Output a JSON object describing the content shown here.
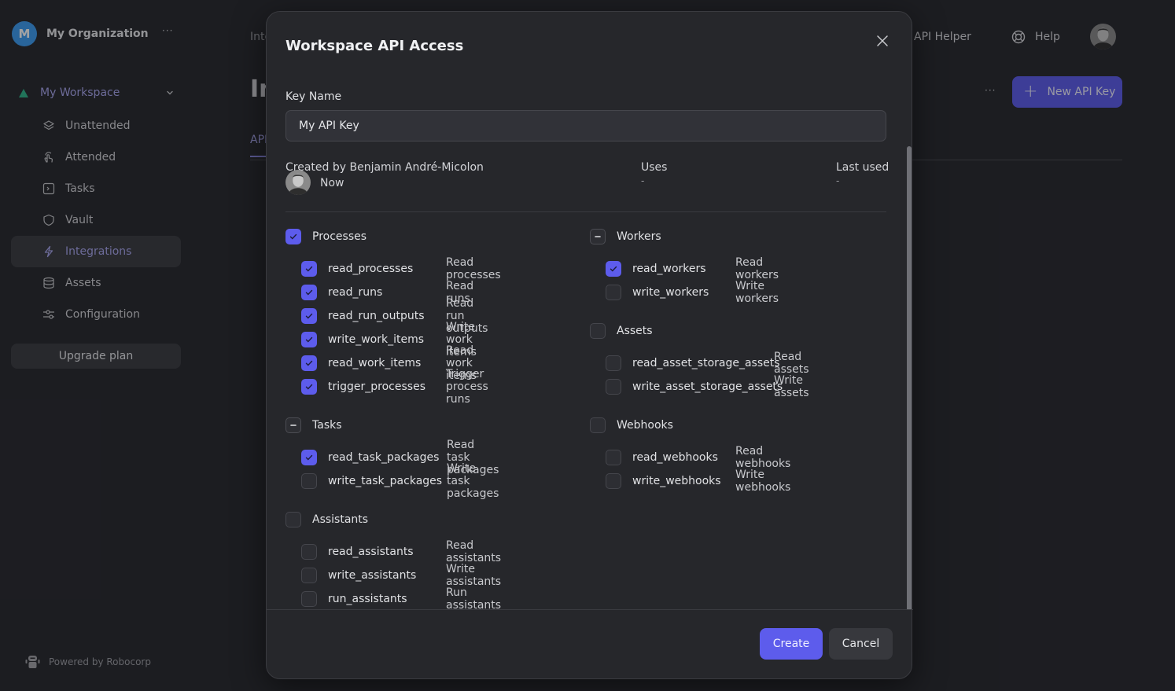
{
  "sidebar": {
    "org_initial": "M",
    "org_name": "My Organization",
    "more": "···",
    "workspace": "My Workspace",
    "items": [
      {
        "label": "Unattended",
        "icon": "layers-icon"
      },
      {
        "label": "Attended",
        "icon": "hand-pointer-icon"
      },
      {
        "label": "Tasks",
        "icon": "terminal-icon"
      },
      {
        "label": "Vault",
        "icon": "shield-icon"
      },
      {
        "label": "Integrations",
        "icon": "lightning-icon",
        "active": true
      },
      {
        "label": "Assets",
        "icon": "database-icon"
      },
      {
        "label": "Configuration",
        "icon": "sliders-icon"
      }
    ],
    "upgrade_label": "Upgrade plan",
    "powered_by": "Powered by Robocorp"
  },
  "header": {
    "breadcrumb": "Integrations",
    "page_title": "Integrations",
    "tab_api": "API",
    "api_helper": "API Helper",
    "help": "Help",
    "more": "···",
    "new_api_key": "New API Key"
  },
  "modal": {
    "title": "Workspace API Access",
    "key_name_label": "Key Name",
    "key_name_value": "My API Key",
    "created_by": "Created by Benjamin André-Micolon",
    "created_time": "Now",
    "uses_label": "Uses",
    "uses_value": "-",
    "last_used_label": "Last used",
    "last_used_value": "-",
    "groups": {
      "processes": {
        "label": "Processes",
        "state": "checked",
        "perms": [
          {
            "name": "read_processes",
            "desc": "Read processes",
            "checked": true
          },
          {
            "name": "read_runs",
            "desc": "Read runs",
            "checked": true
          },
          {
            "name": "read_run_outputs",
            "desc": "Read run outputs",
            "checked": true
          },
          {
            "name": "write_work_items",
            "desc": "Write work items",
            "checked": true
          },
          {
            "name": "read_work_items",
            "desc": "Read work items",
            "checked": true
          },
          {
            "name": "trigger_processes",
            "desc": "Trigger process runs",
            "checked": true
          }
        ]
      },
      "workers": {
        "label": "Workers",
        "state": "indeterminate",
        "perms": [
          {
            "name": "read_workers",
            "desc": "Read workers",
            "checked": true
          },
          {
            "name": "write_workers",
            "desc": "Write workers",
            "checked": false
          }
        ]
      },
      "assets": {
        "label": "Assets",
        "state": "unchecked",
        "perms": [
          {
            "name": "read_asset_storage_assets",
            "desc": "Read assets",
            "checked": false
          },
          {
            "name": "write_asset_storage_assets",
            "desc": "Write assets",
            "checked": false
          }
        ]
      },
      "tasks": {
        "label": "Tasks",
        "state": "indeterminate",
        "perms": [
          {
            "name": "read_task_packages",
            "desc": "Read task packages",
            "checked": true
          },
          {
            "name": "write_task_packages",
            "desc": "Write task packages",
            "checked": false
          }
        ]
      },
      "webhooks": {
        "label": "Webhooks",
        "state": "unchecked",
        "perms": [
          {
            "name": "read_webhooks",
            "desc": "Read webhooks",
            "checked": false
          },
          {
            "name": "write_webhooks",
            "desc": "Write webhooks",
            "checked": false
          }
        ]
      },
      "assistants": {
        "label": "Assistants",
        "state": "unchecked",
        "perms": [
          {
            "name": "read_assistants",
            "desc": "Read assistants",
            "checked": false
          },
          {
            "name": "write_assistants",
            "desc": "Write assistants",
            "checked": false
          },
          {
            "name": "run_assistants",
            "desc": "Run assistants",
            "checked": false
          }
        ]
      }
    },
    "create_label": "Create",
    "cancel_label": "Cancel"
  },
  "colors": {
    "accent": "#5d5cec",
    "accent_text": "#a9a7ef",
    "workspace_icon": "#2fb58a",
    "org_avatar": "#3d9df3"
  }
}
